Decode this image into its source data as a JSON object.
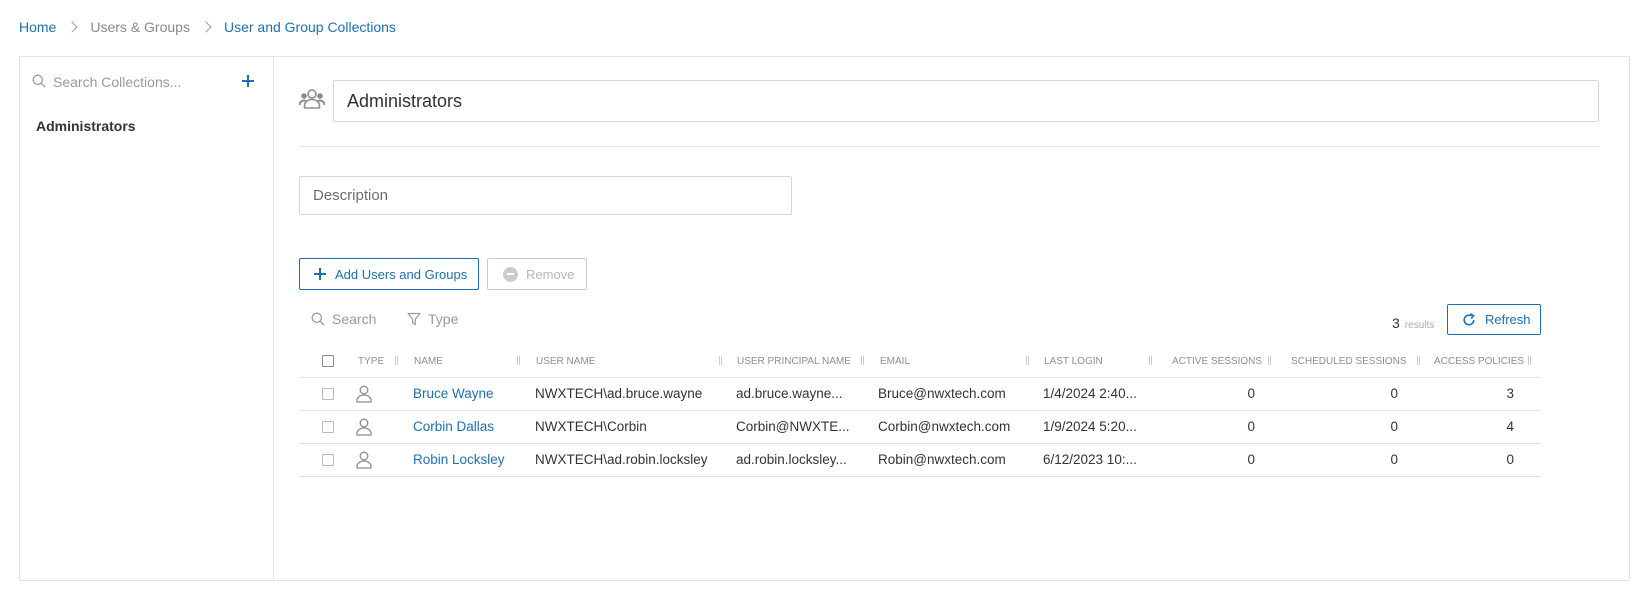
{
  "breadcrumb": {
    "home": "Home",
    "users_groups": "Users & Groups",
    "current": "User and Group Collections"
  },
  "sidebar": {
    "search_placeholder": "Search Collections...",
    "items": [
      {
        "label": "Administrators"
      }
    ]
  },
  "collection": {
    "name": "Administrators",
    "description_placeholder": "Description"
  },
  "actions": {
    "add_label": "Add Users and Groups",
    "remove_label": "Remove"
  },
  "filters": {
    "search_label": "Search",
    "type_label": "Type"
  },
  "results": {
    "count": "3",
    "label": "results",
    "refresh_label": "Refresh"
  },
  "table": {
    "columns": [
      "Type",
      "Name",
      "User Name",
      "User Principal Name",
      "Email",
      "Last Login",
      "Active Sessions",
      "Scheduled Sessions",
      "Access Policies"
    ],
    "rows": [
      {
        "type_icon": "user-icon",
        "name": "Bruce Wayne",
        "user_name": "NWXTECH\\ad.bruce.wayne",
        "upn": "ad.bruce.wayne...",
        "email": "Bruce@nwxtech.com",
        "last_login": "1/4/2024 2:40...",
        "active_sessions": "0",
        "scheduled_sessions": "0",
        "access_policies": "3"
      },
      {
        "type_icon": "user-icon",
        "name": "Corbin Dallas",
        "user_name": "NWXTECH\\Corbin",
        "upn": "Corbin@NWXTE...",
        "email": "Corbin@nwxtech.com",
        "last_login": "1/9/2024 5:20...",
        "active_sessions": "0",
        "scheduled_sessions": "0",
        "access_policies": "4"
      },
      {
        "type_icon": "user-icon",
        "name": "Robin Locksley",
        "user_name": "NWXTECH\\ad.robin.locksley",
        "upn": "ad.robin.locksley...",
        "email": "Robin@nwxtech.com",
        "last_login": "6/12/2023 10:...",
        "active_sessions": "0",
        "scheduled_sessions": "0",
        "access_policies": "0"
      }
    ]
  },
  "colors": {
    "link": "#1f6fb2",
    "border": "#e3e3e3",
    "muted": "#8f8f8f"
  }
}
